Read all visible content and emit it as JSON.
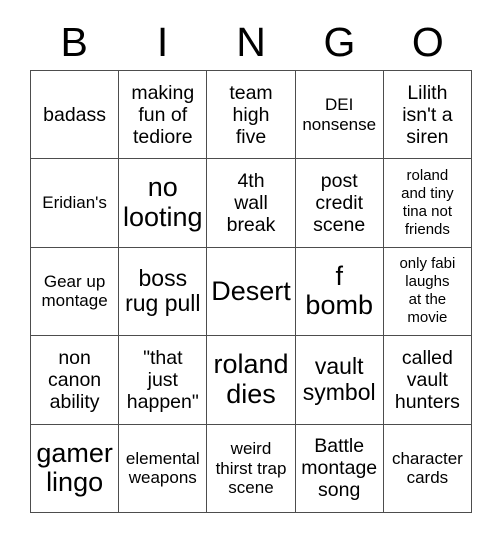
{
  "card": {
    "title": "BINGO",
    "header_letters": [
      "B",
      "I",
      "N",
      "G",
      "O"
    ],
    "grid_size": "5x5",
    "border_color": "#4d4d4d",
    "background_color": "#ffffff",
    "text_color": "#000000",
    "cells": [
      {
        "text": "badass",
        "size": "m"
      },
      {
        "text": "making\nfun of\ntediore",
        "size": "m"
      },
      {
        "text": "team\nhigh\nfive",
        "size": "m"
      },
      {
        "text": "DEI\nnonsense",
        "size": "s"
      },
      {
        "text": "Lilith\nisn't a\nsiren",
        "size": "m"
      },
      {
        "text": "Eridian's",
        "size": "s"
      },
      {
        "text": "no\nlooting",
        "size": "xl"
      },
      {
        "text": "4th\nwall\nbreak",
        "size": "m"
      },
      {
        "text": "post\ncredit\nscene",
        "size": "m"
      },
      {
        "text": "roland\nand tiny\ntina not\nfriends",
        "size": "xs"
      },
      {
        "text": "Gear up\nmontage",
        "size": "s"
      },
      {
        "text": "boss\nrug pull",
        "size": "l"
      },
      {
        "text": "Desert",
        "size": "xl"
      },
      {
        "text": "f\nbomb",
        "size": "xl"
      },
      {
        "text": "only fabi\nlaughs\nat the\nmovie",
        "size": "xs"
      },
      {
        "text": "non\ncanon\nability",
        "size": "m"
      },
      {
        "text": "\"that\njust\nhappen\"",
        "size": "m"
      },
      {
        "text": "roland\ndies",
        "size": "xl"
      },
      {
        "text": "vault\nsymbol",
        "size": "l"
      },
      {
        "text": "called\nvault\nhunters",
        "size": "m"
      },
      {
        "text": "gamer\nlingo",
        "size": "xl"
      },
      {
        "text": "elemental\nweapons",
        "size": "s"
      },
      {
        "text": "weird\nthirst trap\nscene",
        "size": "s"
      },
      {
        "text": "Battle\nmontage\nsong",
        "size": "m"
      },
      {
        "text": "character\ncards",
        "size": "s"
      }
    ]
  }
}
